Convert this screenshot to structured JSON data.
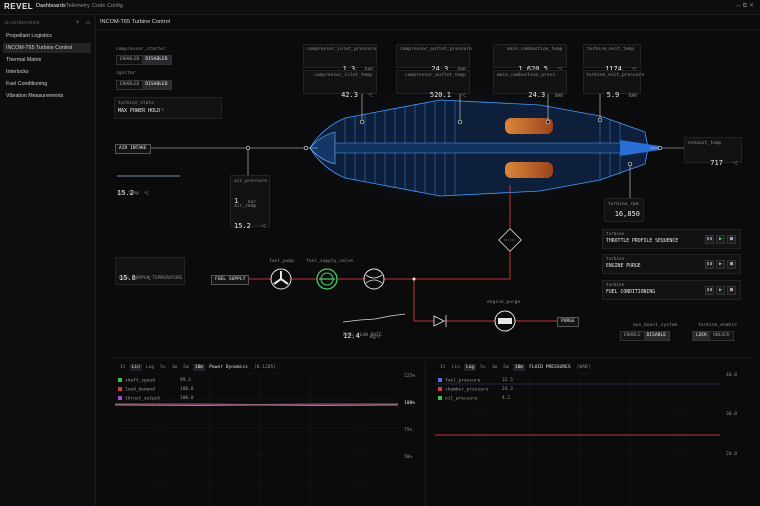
{
  "app": {
    "logo": "REVEL",
    "tabs": [
      "Dashboards",
      "Telemetry",
      "Code",
      "Config"
    ],
    "active_tab": "Dashboards",
    "window_controls": "— ⧉ ✕"
  },
  "sidebar": {
    "header": "DASHBOARDS",
    "add_icon": "plus-icon",
    "collapse_icon": "panel-icon",
    "items": [
      {
        "label": "Propellant Logistics"
      },
      {
        "label": "INCOM-T65 Turbine Control"
      },
      {
        "label": "Thermal Matrix"
      },
      {
        "label": "Interlocks"
      },
      {
        "label": "Fuel Conditioning"
      },
      {
        "label": "Vibration Measurements"
      }
    ],
    "active_index": 1
  },
  "page": {
    "title": "INCOM-T65 Turbine Control"
  },
  "toggles": {
    "compressor_starter": {
      "label": "compressor_starter",
      "options": [
        "ENABLED",
        "DISABLED"
      ],
      "selected": "DISABLED"
    },
    "ignitor": {
      "label": "ignitor",
      "options": [
        "ENABLED",
        "DISABLED"
      ],
      "selected": "DISABLED"
    }
  },
  "turbine_state": {
    "label": "turbine_state",
    "value": "MAX POWER HOLD"
  },
  "metrics": {
    "compressor_inlet_pressure": {
      "label": "compressor_inlet_pressure",
      "value": "1.3",
      "unit": "BAR"
    },
    "compressor_inlet_temp": {
      "label": "compressor_inlet_temp",
      "value": "42.3",
      "unit": "°C"
    },
    "compressor_outlet_pressure": {
      "label": "compressor_outlet_pressure",
      "value": "24.3",
      "unit": "BAR"
    },
    "compressor_outlet_temp": {
      "label": "compressor_outlet_temp",
      "value": "520.1",
      "unit": "°C"
    },
    "main_combustion_temp": {
      "label": "main_combustion_temp",
      "value": "1,620.5",
      "unit": "°C"
    },
    "main_combustion_press": {
      "label": "main_combustion_press",
      "value": "24.3",
      "unit": "BAR"
    },
    "turbine_exit_temp": {
      "label": "turbine_exit_temp",
      "value": "1174",
      "unit": "°C"
    },
    "turbine_exit_pressure": {
      "label": "turbine_exit_pressure",
      "value": "5.9",
      "unit": "BAR"
    },
    "exhaust_temp": {
      "label": "exhaust_temp",
      "value": "717",
      "unit": "°C"
    },
    "turbine_rpm": {
      "label": "turbine_rpm",
      "value": "16,850",
      "unit": ""
    },
    "air_pressure": {
      "label": "air_pressure",
      "value": "1",
      "unit": "bar"
    },
    "air_temp": {
      "label": "air_temp",
      "value": "15.2",
      "unit": "°C"
    },
    "air_temp_left": {
      "label": "air_temp",
      "value": "15.2",
      "unit": "°C"
    },
    "fuel_supply_temp": {
      "label": "FUEL SUPPLY TEMPERATURE",
      "value": "15.8",
      "unit": "°C"
    },
    "fuel_flow_rate": {
      "label": "FUEL FLOW RATE",
      "value": "12.4",
      "unit": "kg/s"
    }
  },
  "diagram": {
    "air_intake": "AIR INTAKE",
    "fuel_supply": "FUEL SUPPLY",
    "fuel_pump": "fuel_pump",
    "fuel_supply_valve": "fuel_supply_valve",
    "engine_purge": "engine_purge",
    "purge": "PURGE"
  },
  "controls": [
    {
      "key": "turbine",
      "title": "THROTTLE PROFILE SEQUENCE"
    },
    {
      "key": "turbine",
      "title": "ENGINE PURGE"
    },
    {
      "key": "turbine",
      "title": "FUEL CONDITIONING"
    }
  ],
  "aux_boost": {
    "label": "aux_boost_system",
    "options": [
      "ENABLE",
      "DISABLE"
    ],
    "selected": "DISABLE"
  },
  "turbine_enable": {
    "label": "turbine_enable",
    "options": [
      "LOCK",
      "UNLOCK"
    ],
    "selected": "LOCK"
  },
  "chart_left": {
    "toolbar": [
      "1t",
      "Lin",
      "Log",
      "5s",
      "1m",
      "5m",
      "10m"
    ],
    "active": [
      "Lin",
      "10m"
    ],
    "title": "Power Dynamics",
    "tag": "[0.1285]",
    "legend": [
      {
        "name": "shaft_speed",
        "value": "99.2",
        "color": "#3fbf4a"
      },
      {
        "name": "load_demand",
        "value": "100.0",
        "color": "#d23c3c"
      },
      {
        "name": "thrust_output",
        "value": "100.0",
        "color": "#9b4fd6"
      }
    ],
    "y_ticks": [
      "125%",
      "100%",
      "75%",
      "50%"
    ]
  },
  "chart_right": {
    "toolbar": [
      "1t",
      "Lin",
      "Log",
      "5s",
      "1m",
      "5m",
      "10m"
    ],
    "active": [
      "Log",
      "10m"
    ],
    "title": "FLUID PRESSURES",
    "tag": "[BAR]",
    "legend": [
      {
        "name": "fuel_pressure",
        "value": "32.5",
        "color": "#5a6fe0"
      },
      {
        "name": "chamber_pressure",
        "value": "24.3",
        "color": "#d23c3c"
      },
      {
        "name": "oil_pressure",
        "value": "4.2",
        "color": "#3fbf4a"
      }
    ],
    "y_ticks": [
      "40.0",
      "30.0",
      "20.0"
    ]
  },
  "colors": {
    "accent_red": "#c23434",
    "engine_blue": "#3a8cff",
    "green": "#4fd36a"
  }
}
